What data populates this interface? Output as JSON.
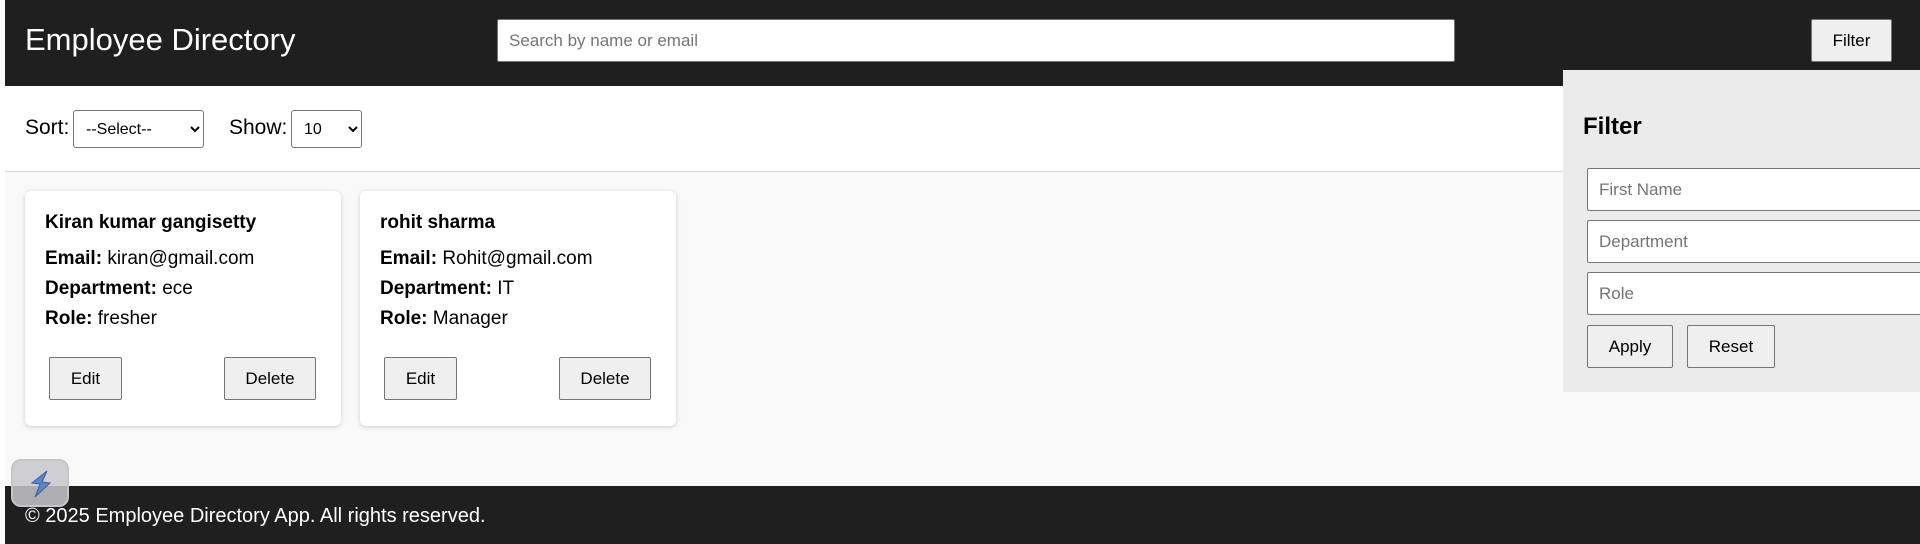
{
  "header": {
    "title": "Employee Directory",
    "search_placeholder": "Search by name or email",
    "filter_label": "Filter"
  },
  "controls": {
    "sort_label": "Sort:",
    "sort_selected": "--Select--",
    "show_label": "Show:",
    "show_selected": "10"
  },
  "employees": [
    {
      "name": "Kiran kumar gangisetty",
      "email_label": "Email:",
      "email": "kiran@gmail.com",
      "department_label": "Department:",
      "department": "ece",
      "role_label": "Role:",
      "role": "fresher",
      "edit_label": "Edit",
      "delete_label": "Delete"
    },
    {
      "name": "rohit sharma",
      "email_label": "Email:",
      "email": "Rohit@gmail.com",
      "department_label": "Department:",
      "department": "IT",
      "role_label": "Role:",
      "role": "Manager",
      "edit_label": "Edit",
      "delete_label": "Delete"
    }
  ],
  "filter_panel": {
    "title": "Filter",
    "first_name_placeholder": "First Name",
    "department_placeholder": "Department",
    "role_placeholder": "Role",
    "apply_label": "Apply",
    "reset_label": "Reset"
  },
  "footer": {
    "text": "© 2025 Employee Directory App. All rights reserved."
  },
  "colors": {
    "header_bg": "#1f1f1f",
    "page_bg": "#f9f9f9",
    "panel_bg": "#ebebeb",
    "button_bg": "#efefef"
  },
  "icons": {
    "floating_widget": "lightning-bolt-icon"
  }
}
